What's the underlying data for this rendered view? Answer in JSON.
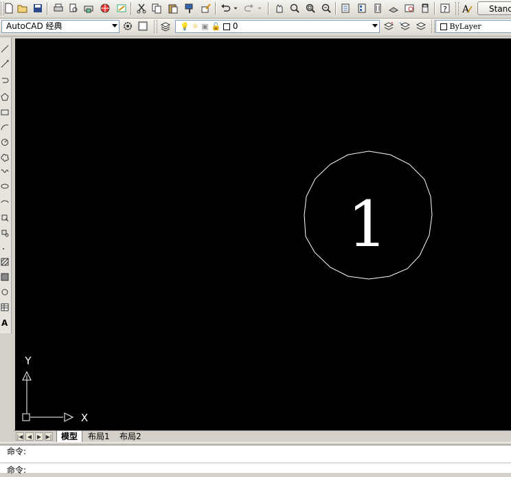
{
  "toolbar": {
    "workspace_button_label": "Stand",
    "workspace_combo_value": "AutoCAD 经典",
    "layer_combo_value": "0",
    "color_combo_value": "ByLayer"
  },
  "drawing": {
    "circle_label": "1",
    "ucs_x_label": "X",
    "ucs_y_label": "Y",
    "background_color": "#000000",
    "line_color": "#ffffff"
  },
  "tabs": [
    {
      "label": "模型",
      "active": true
    },
    {
      "label": "布局1",
      "active": false
    },
    {
      "label": "布局2",
      "active": false
    }
  ],
  "command": {
    "line1": "命令:",
    "line2": "命令:"
  }
}
